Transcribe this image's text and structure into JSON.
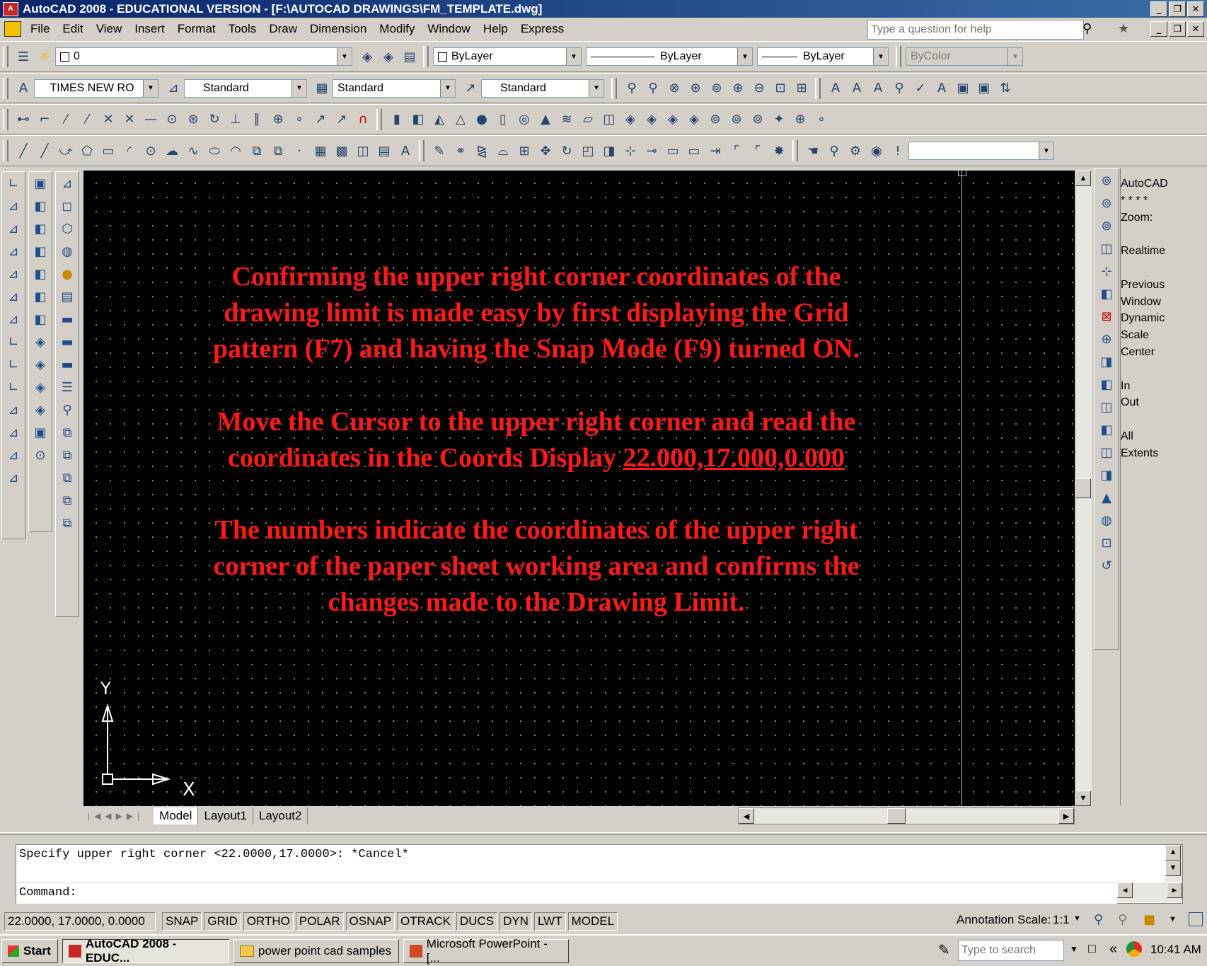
{
  "window": {
    "title": "AutoCAD 2008 - EDUCATIONAL VERSION - [F:\\AUTOCAD DRAWINGS\\FM_TEMPLATE.dwg]"
  },
  "menu": {
    "items": [
      "File",
      "Edit",
      "View",
      "Insert",
      "Format",
      "Tools",
      "Draw",
      "Dimension",
      "Modify",
      "Window",
      "Help",
      "Express"
    ],
    "help_placeholder": "Type a question for help"
  },
  "layers": {
    "layer_value": "0",
    "color_value": "ByLayer",
    "linetype_value": "ByLayer",
    "lineweight_value": "ByLayer",
    "plotstyle_value": "ByColor"
  },
  "styles": {
    "font_value": "TIMES NEW RO",
    "text_style": "Standard",
    "dim_style": "Standard",
    "table_style": "Standard"
  },
  "canvas": {
    "paragraph1": [
      "Confirming the upper right corner coordinates of the",
      "drawing limit is made easy by  first displaying  the Grid",
      "pattern (F7)  and having the Snap Mode (F9) turned ON."
    ],
    "paragraph2_line1": "Move the Cursor to the upper right corner  and read the",
    "paragraph2_line2_prefix": "coordinates in the Coords Display ",
    "paragraph2_coords": "22.000,17.000,0.000",
    "paragraph3": [
      "The numbers indicate the coordinates of the upper  right",
      "corner of the paper sheet  working area and confirms the",
      "changes made to the Drawing  Limit."
    ],
    "ucs_y": "Y",
    "ucs_x": "X"
  },
  "layout_tabs": [
    "Model",
    "Layout1",
    "Layout2"
  ],
  "zoom_palette": {
    "lines": [
      "AutoCAD",
      "* * * *",
      "Zoom:",
      "",
      "Realtime",
      "",
      "Previous",
      "Window",
      "Dynamic",
      "Scale",
      "Center",
      "",
      "In",
      "Out",
      "",
      "All",
      "Extents"
    ]
  },
  "command": {
    "history": "Specify upper right corner <22.0000,17.0000>: *Cancel*",
    "prompt": "Command:"
  },
  "status": {
    "coords": "22.0000, 17.0000, 0.0000",
    "toggles": [
      "SNAP",
      "GRID",
      "ORTHO",
      "POLAR",
      "OSNAP",
      "OTRACK",
      "DUCS",
      "DYN",
      "LWT",
      "MODEL"
    ],
    "annotation_label": "Annotation Scale:",
    "annotation_value": "1:1"
  },
  "taskbar": {
    "start": "Start",
    "tasks": [
      "AutoCAD 2008 - EDUC...",
      "power point cad samples",
      "Microsoft PowerPoint - [..."
    ],
    "search_placeholder": "Type to search",
    "time": "10:41 AM"
  },
  "colors": {
    "accent": "#0a246a",
    "canvas_bg": "#000000",
    "annotation_text": "#ff1a1a"
  }
}
